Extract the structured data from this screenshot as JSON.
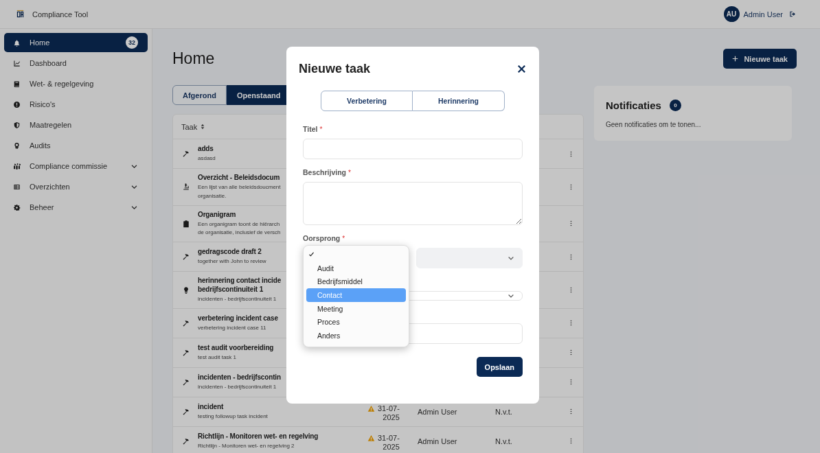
{
  "app": {
    "title": "Compliance Tool"
  },
  "user": {
    "initials": "AU",
    "name": "Admin User"
  },
  "sidebar": {
    "items": [
      {
        "label": "Home",
        "selected": true,
        "badge": "32"
      },
      {
        "label": "Dashboard",
        "selected": false
      },
      {
        "label": "Wet- & regelgeving",
        "selected": false
      },
      {
        "label": "Risico's",
        "selected": false
      },
      {
        "label": "Maatregelen",
        "selected": false
      },
      {
        "label": "Audits",
        "selected": false
      },
      {
        "label": "Compliance commissie",
        "selected": false,
        "expanded": false
      },
      {
        "label": "Overzichten",
        "selected": false,
        "expanded": false
      },
      {
        "label": "Beheer",
        "selected": false,
        "expanded": false
      }
    ]
  },
  "page": {
    "title": "Home",
    "new_button": "Nieuwe taak"
  },
  "tabs": [
    {
      "label": "Afgerond",
      "selected": false
    },
    {
      "label": "Openstaand",
      "selected": true
    }
  ],
  "table": {
    "columns": [
      "Taak"
    ],
    "rows": [
      {
        "kind": "hammer",
        "title": [
          "adds"
        ],
        "description": [
          "asdasd"
        ]
      },
      {
        "kind": "microscope",
        "title": [
          "Overzicht - Beleidsdocum"
        ],
        "description": [
          "Een lijst van alle beleidsdoucment",
          "organisatie."
        ]
      },
      {
        "kind": "clipboard",
        "title": [
          "Organigram"
        ],
        "description": [
          "Een organigram toont de hiërarch",
          "de organisatie, inclusief de versch"
        ]
      },
      {
        "kind": "hammer",
        "title": [
          "gedragscode draft 2"
        ],
        "description": [
          "together with John to review"
        ]
      },
      {
        "kind": "bulb",
        "title": [
          "herinnering contact incide",
          "bedrijfscontinuiteit 1"
        ],
        "description": [
          "incidenten - bedrijfscontinuiteit 1"
        ]
      },
      {
        "kind": "hammer",
        "title": [
          "verbetering incident case"
        ],
        "description": [
          "verbetering incident case 11"
        ]
      },
      {
        "kind": "hammer",
        "title": [
          "test audit voorbereiding"
        ],
        "description": [
          "test audit task 1"
        ]
      },
      {
        "kind": "hammer",
        "title": [
          "incidenten - bedrijfscontin"
        ],
        "description": [
          "incidenten - bedrijfscontinuiteit 1"
        ]
      },
      {
        "kind": "hammer",
        "title": [
          "incident"
        ],
        "description": [
          "testing followup task incident"
        ],
        "warning": true,
        "date": [
          "31-07-",
          "2025"
        ],
        "assignee": "Admin User",
        "status": "N.v.t."
      },
      {
        "kind": "hammer",
        "title": [
          "Richtlijn - Monitoren wet- en regelving"
        ],
        "description": [
          "Richtlijn - Monitoren wet- en regelving 2"
        ],
        "warning": true,
        "date": [
          "31-07-",
          "2025"
        ],
        "assignee": "Admin User",
        "status": "N.v.t."
      }
    ]
  },
  "notifications": {
    "title": "Notificaties",
    "count": "0",
    "empty_text": "Geen notificaties om te tonen..."
  },
  "modal": {
    "title": "Nieuwe taak",
    "required_mark": "*",
    "types": [
      {
        "label": "Verbetering",
        "selected": false
      },
      {
        "label": "Herinnering",
        "selected": false
      }
    ],
    "fields": [
      {
        "kind": "text",
        "label": "Titel",
        "required": true
      },
      {
        "kind": "textarea",
        "label": "Beschrijving",
        "required": true
      },
      {
        "kind": "select-pair",
        "label": "Oorsprong",
        "required": true,
        "second_disabled": true
      },
      {
        "kind": "select"
      },
      {
        "kind": "text"
      }
    ],
    "dropdown": {
      "blank_selected": true,
      "options": [
        {
          "label": "Audit",
          "highlighted": false
        },
        {
          "label": "Bedrijfsmiddel",
          "highlighted": false
        },
        {
          "label": "Contact",
          "highlighted": true
        },
        {
          "label": "Meeting",
          "highlighted": false
        },
        {
          "label": "Proces",
          "highlighted": false
        },
        {
          "label": "Anders",
          "highlighted": false
        }
      ]
    },
    "save_button": "Opslaan"
  }
}
